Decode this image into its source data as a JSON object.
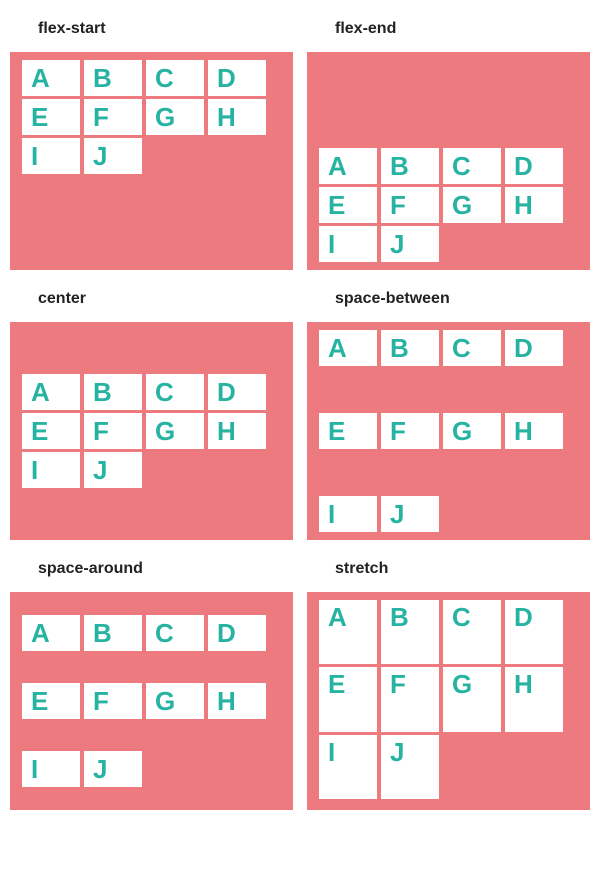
{
  "examples": [
    {
      "id": "flex-start",
      "label": "flex-start",
      "class": "ac-flex-start"
    },
    {
      "id": "flex-end",
      "label": "flex-end",
      "class": "ac-flex-end"
    },
    {
      "id": "center",
      "label": "center",
      "class": "ac-center"
    },
    {
      "id": "space-between",
      "label": "space-between",
      "class": "ac-space-between"
    },
    {
      "id": "space-around",
      "label": "space-around",
      "class": "ac-space-around"
    },
    {
      "id": "stretch",
      "label": "stretch",
      "class": "ac-stretch"
    }
  ],
  "rows": [
    [
      "A",
      "B",
      "C",
      "D"
    ],
    [
      "E",
      "F",
      "G",
      "H"
    ],
    [
      "I",
      "J"
    ]
  ],
  "colors": {
    "container_bg": "#ec7a7e",
    "cell_bg": "#ffffff",
    "cell_text": "#26b3a2"
  }
}
